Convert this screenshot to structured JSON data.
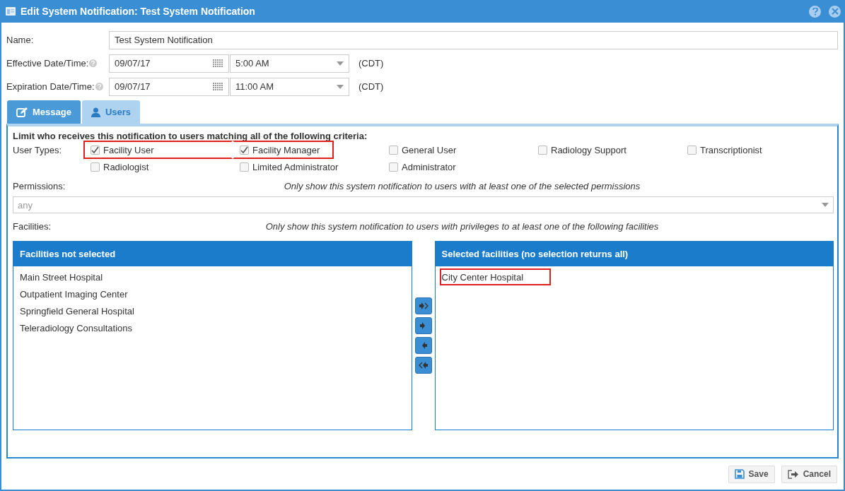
{
  "window": {
    "title": "Edit System Notification: Test System Notification"
  },
  "fields": [
    {
      "kind": "text",
      "label": "Name:",
      "value": "Test System Notification"
    },
    {
      "kind": "datetime",
      "label": "Effective Date/Time:",
      "help": true,
      "date": "09/07/17",
      "time": "5:00 AM",
      "zone": "(CDT)"
    },
    {
      "kind": "datetime",
      "label": "Expiration Date/Time:",
      "help": true,
      "date": "09/07/17",
      "time": "11:00 AM",
      "zone": "(CDT)"
    }
  ],
  "tabs": [
    {
      "label": "Message",
      "kind": "edit",
      "selected": false
    },
    {
      "label": "Users",
      "kind": "user",
      "selected": true
    }
  ],
  "criteria_title": "Limit who receives this notification to users matching all of the following criteria:",
  "user_types_label": "User Types:",
  "user_types": [
    {
      "label": "Facility User",
      "checked": true,
      "highlighted": true
    },
    {
      "label": "Facility Manager",
      "checked": true,
      "highlighted": true
    },
    {
      "label": "General User",
      "checked": false,
      "highlighted": false
    },
    {
      "label": "Radiology Support",
      "checked": false,
      "highlighted": false
    },
    {
      "label": "Transcriptionist",
      "checked": false,
      "highlighted": false
    },
    {
      "label": "Radiologist",
      "checked": false,
      "highlighted": false
    },
    {
      "label": "Limited Administrator",
      "checked": false,
      "highlighted": false
    },
    {
      "label": "Administrator",
      "checked": false,
      "highlighted": false
    }
  ],
  "permissions": {
    "label": "Permissions:",
    "hint": "Only show this system notification to users with at least one of the selected permissions",
    "placeholder": "any"
  },
  "facilities": {
    "label": "Facilities:",
    "hint": "Only show this system notification to users with privileges to at least one of the following facilities",
    "available": {
      "title": "Facilities not selected",
      "items": [
        {
          "label": "Main Street Hospital",
          "highlighted": false
        },
        {
          "label": "Outpatient Imaging Center",
          "highlighted": false
        },
        {
          "label": "Springfield General Hospital",
          "highlighted": false
        },
        {
          "label": "Teleradiology Consultations",
          "highlighted": false
        }
      ]
    },
    "selected": {
      "title": "Selected facilities (no selection returns all)",
      "items": [
        {
          "label": "City Center Hospital",
          "highlighted": true
        }
      ]
    },
    "moves": [
      {
        "kind": "add-all"
      },
      {
        "kind": "add"
      },
      {
        "kind": "remove"
      },
      {
        "kind": "remove-all"
      }
    ]
  },
  "buttons": [
    {
      "label": "Save",
      "kind": "save"
    },
    {
      "label": "Cancel",
      "kind": "cancel"
    }
  ]
}
